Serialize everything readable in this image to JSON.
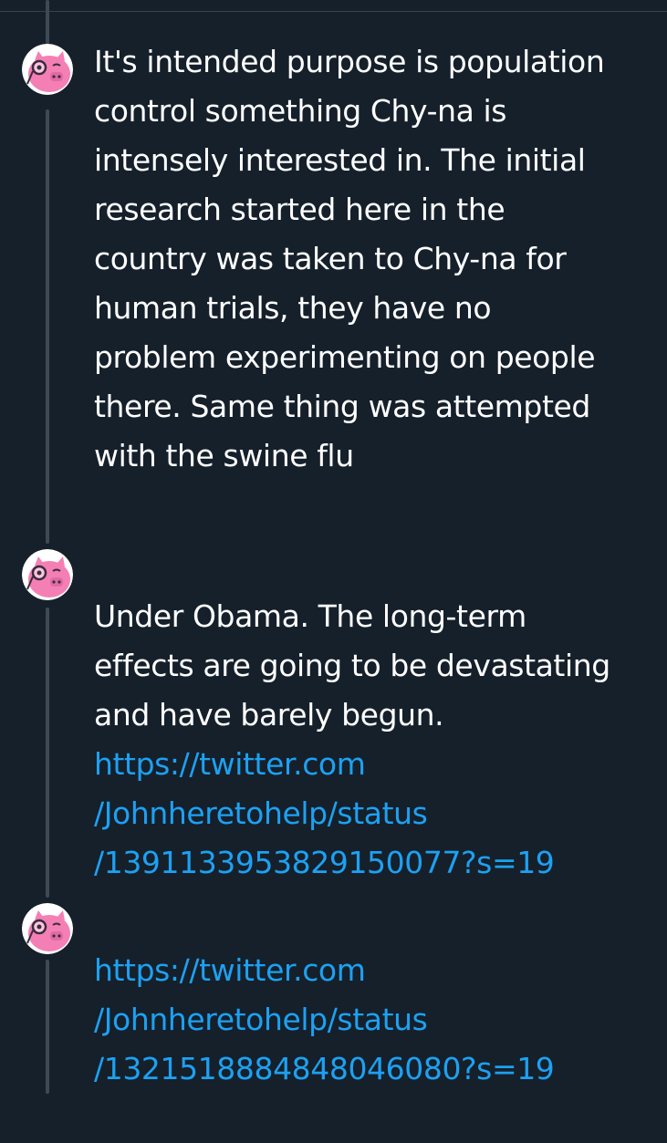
{
  "theme": {
    "background": "#15202b",
    "text": "#ffffff",
    "link": "#1da1f2",
    "thread_line": "#3d4a55",
    "avatar_pink": "#f47fb5"
  },
  "tweets": [
    {
      "avatar_icon": "pig-monocle-avatar-icon",
      "text": "It's intended purpose is population\ncontrol something  Chy-na is\nintensely interested in. The initial\nresearch started here in the\ncountry was taken to Chy-na for\nhuman trials, they have no\nproblem experimenting on people\nthere. Same thing was attempted\nwith the swine flu"
    },
    {
      "avatar_icon": "pig-monocle-avatar-icon",
      "text": "Under Obama. The long-term\neffects are going to be devastating\nand have barely begun.",
      "link": "https://twitter.com\n/Johnheretohelp/status\n/1391133953829150077?s=19"
    },
    {
      "avatar_icon": "pig-monocle-avatar-icon",
      "link": "https://twitter.com\n/Johnheretohelp/status\n/1321518884848046080?s=19"
    }
  ]
}
